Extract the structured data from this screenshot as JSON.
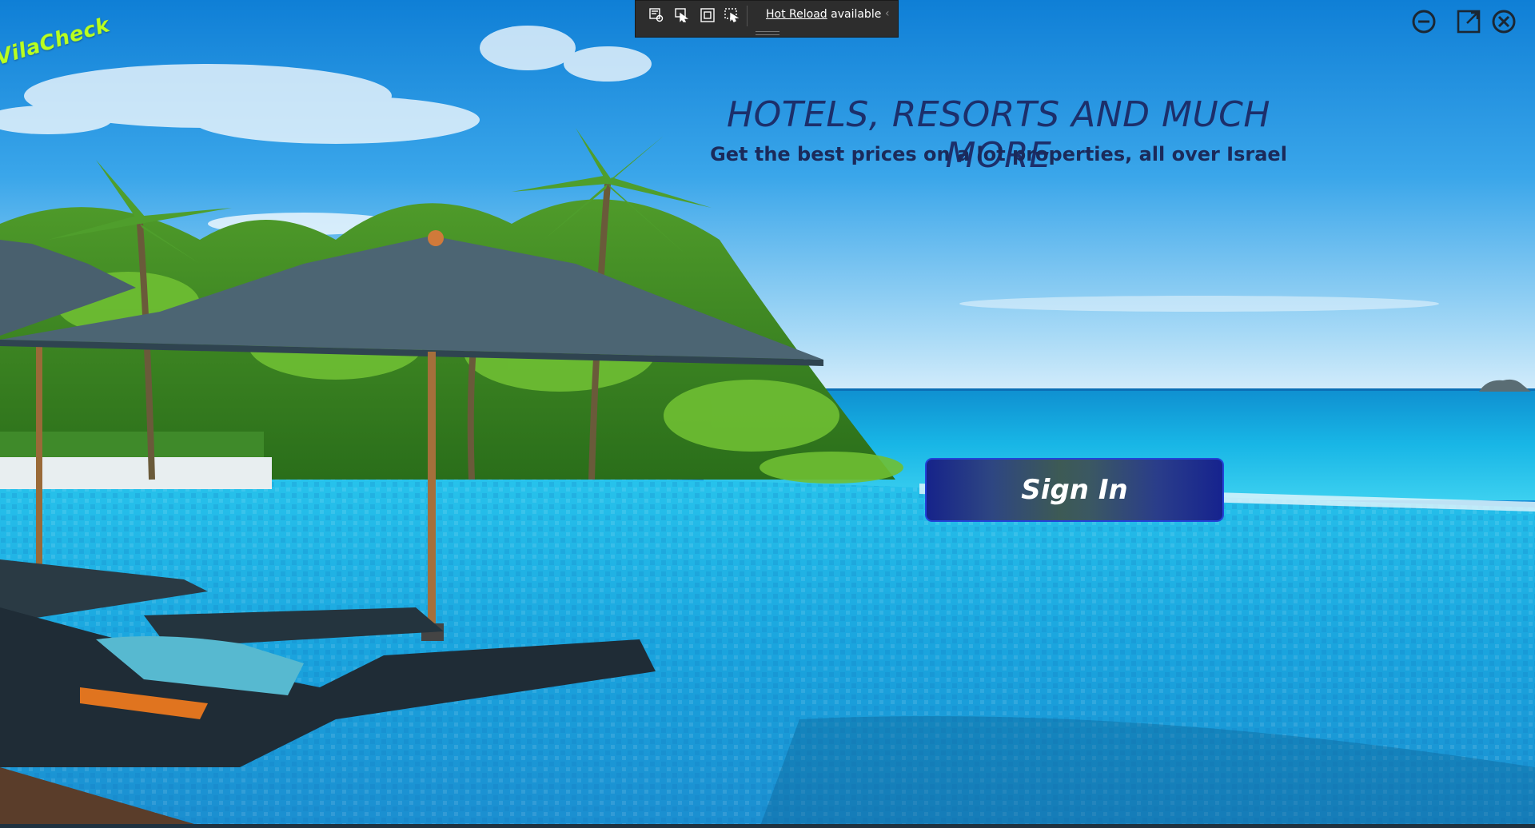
{
  "app": {
    "brand": "VilaCheck"
  },
  "hero": {
    "title": "HOTELS, RESORTS AND MUCH MORE",
    "subtitle": "Get the best prices on a lot properties, all over Israel"
  },
  "actions": {
    "sign_in_label": "Sign In"
  },
  "dev_toolbar": {
    "hot_reload_link": "Hot Reload",
    "hot_reload_status": "available",
    "tools": [
      "live-visual-tree-icon",
      "select-element-icon",
      "display-layout-adorners-icon",
      "track-focused-element-icon"
    ]
  },
  "window_controls": [
    "minimize-icon",
    "maximize-icon",
    "close-icon"
  ],
  "colors": {
    "title": "#1c2f6b",
    "brand": "#b9ff1f",
    "sign_in_border": "#2243d8",
    "sky": "#1a8fd8",
    "sea": "#19b8e6",
    "pool": "#19a9e0"
  }
}
